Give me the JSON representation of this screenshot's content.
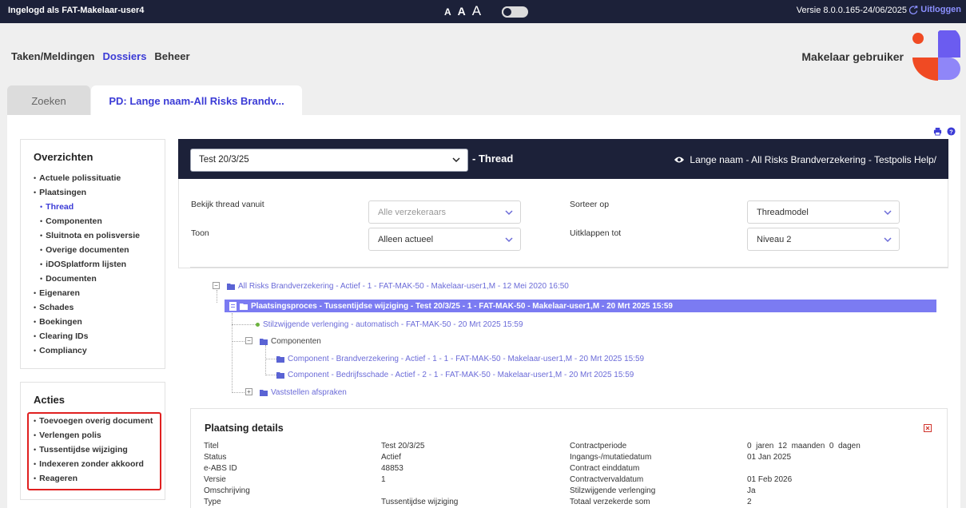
{
  "topbar": {
    "login": "Ingelogd als FAT-Makelaar-user4",
    "font_sizes": [
      "A",
      "A",
      "A"
    ],
    "version": "Versie 8.0.0.165-24/06/2025",
    "logout": "Uitloggen"
  },
  "nav": {
    "items": [
      "Taken/Meldingen",
      "Dossiers",
      "Beheer"
    ],
    "active": "Dossiers"
  },
  "user": "Makelaar gebruiker",
  "tabs": [
    "Zoeken",
    "PD: Lange naam-All Risks Brandv..."
  ],
  "sidebar": {
    "overzichten_title": "Overzichten",
    "overzichten": [
      {
        "label": "Actuele polissituatie",
        "level": 0
      },
      {
        "label": "Plaatsingen",
        "level": 0
      },
      {
        "label": "Thread",
        "level": 1,
        "active": true
      },
      {
        "label": "Componenten",
        "level": 1
      },
      {
        "label": "Sluitnota en polisversie",
        "level": 1
      },
      {
        "label": "Overige documenten",
        "level": 1
      },
      {
        "label": "iDOSplatform lijsten",
        "level": 1
      },
      {
        "label": "Documenten",
        "level": 1
      },
      {
        "label": "Eigenaren",
        "level": 0
      },
      {
        "label": "Schades",
        "level": 0
      },
      {
        "label": "Boekingen",
        "level": 0
      },
      {
        "label": "Clearing IDs",
        "level": 0
      },
      {
        "label": "Compliancy",
        "level": 0
      }
    ],
    "acties_title": "Acties",
    "acties": [
      "Toevoegen overig document",
      "Verlengen polis",
      "Tussentijdse wijziging",
      "Indexeren zonder akkoord",
      "Reageren"
    ]
  },
  "thread": {
    "selected": "Test 20/3/25",
    "label": "- Thread",
    "polis": "Lange naam - All Risks Brandverzekering - Testpolis Help/"
  },
  "filters": {
    "bekijk_label": "Bekijk thread vanuit",
    "bekijk_placeholder": "Alle verzekeraars",
    "sorteer_label": "Sorteer op",
    "sorteer_value": "Threadmodel",
    "toon_label": "Toon",
    "toon_value": "Alleen actueel",
    "uitklappen_label": "Uitklappen tot",
    "uitklappen_value": "Niveau 2"
  },
  "tree": {
    "root": "All Risks Brandverzekering - Actief - 1 - FAT-MAK-50 - Makelaar-user1,M - 12 Mei 2020 16:50",
    "selected": "Plaatsingsproces - Tussentijdse wijziging - Test 20/3/25 - 1 - FAT-MAK-50 - Makelaar-user1,M - 20 Mrt 2025 15:59",
    "verlenging": "Stilzwijgende verlenging - automatisch - FAT-MAK-50 - 20 Mrt 2025 15:59",
    "componenten": "Componenten",
    "comp1": "Component - Brandverzekering - Actief - 1 - 1 - FAT-MAK-50 - Makelaar-user1,M - 20 Mrt 2025 15:59",
    "comp2": "Component - Bedrijfsschade - Actief - 2 - 1 - FAT-MAK-50 - Makelaar-user1,M - 20 Mrt 2025 15:59",
    "afspraken": "Vaststellen afspraken"
  },
  "details": {
    "title": "Plaatsing details",
    "left": [
      {
        "label": "Titel",
        "value": "Test 20/3/25"
      },
      {
        "label": "Status",
        "value": "Actief"
      },
      {
        "label": "e-ABS ID",
        "value": "48853"
      },
      {
        "label": "Versie",
        "value": "1"
      },
      {
        "label": "Omschrijving",
        "value": ""
      },
      {
        "label": "Type",
        "value": "Tussentijdse wijziging"
      }
    ],
    "right": [
      {
        "label": "Contractperiode",
        "value": "0  jaren  12  maanden  0  dagen"
      },
      {
        "label": "Ingangs-/mutatiedatum",
        "value": "01 Jan 2025"
      },
      {
        "label": "Contract einddatum",
        "value": ""
      },
      {
        "label": "Contractvervaldatum",
        "value": "01 Feb 2026"
      },
      {
        "label": "Stilzwijgende verlenging",
        "value": "Ja"
      },
      {
        "label": "Totaal verzekerde som",
        "value": "2"
      }
    ]
  },
  "colors": {
    "accent": "#3b3bd6",
    "dark": "#1c2139",
    "highlight": "#7b7bf2",
    "alert": "#e02020"
  }
}
